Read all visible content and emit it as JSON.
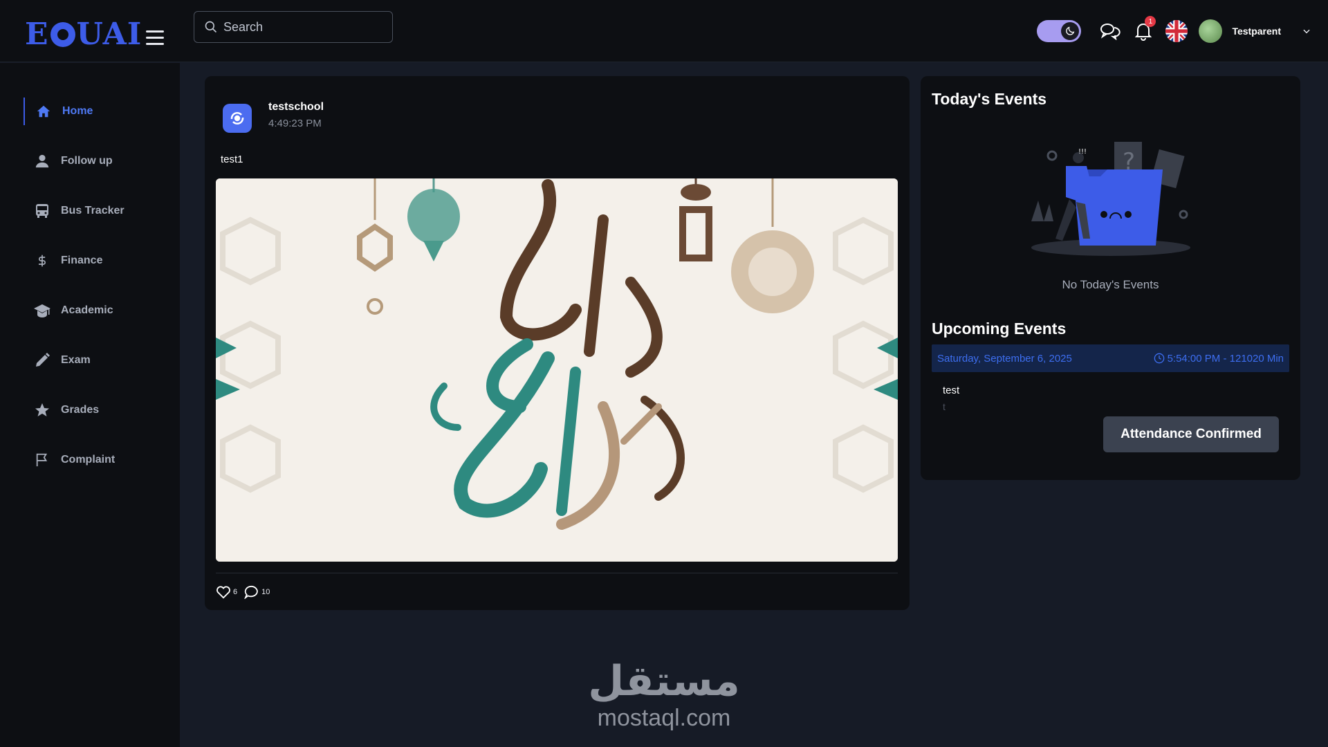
{
  "app": {
    "logo_text": "EDUAI",
    "logo_left": "E",
    "logo_right": "UAI"
  },
  "search": {
    "placeholder": "Search"
  },
  "header": {
    "username": "Testparent",
    "notification_count": "1"
  },
  "colors": {
    "accent": "#3d5ce8",
    "toggle": "#a79cf0",
    "badge": "#e53946",
    "event_bar": "#14254a"
  },
  "sidebar": {
    "items": [
      {
        "label": "Home",
        "icon": "home-icon",
        "active": true
      },
      {
        "label": "Follow up",
        "icon": "user-icon"
      },
      {
        "label": "Bus Tracker",
        "icon": "bus-icon"
      },
      {
        "label": "Finance",
        "icon": "dollar-icon"
      },
      {
        "label": "Academic",
        "icon": "graduation-cap-icon"
      },
      {
        "label": "Exam",
        "icon": "pencil-icon"
      },
      {
        "label": "Grades",
        "icon": "star-icon"
      },
      {
        "label": "Complaint",
        "icon": "flag-icon"
      }
    ]
  },
  "post": {
    "author": "testschool",
    "time": "4:49:23 PM",
    "text": "test1",
    "image_text": "عيد أضحى مبارك",
    "likes": "6",
    "comments": "10"
  },
  "events": {
    "today_title": "Today's Events",
    "today_empty": "No Today's Events",
    "upcoming_title": "Upcoming Events",
    "upcoming": [
      {
        "date": "Saturday, September 6, 2025",
        "time": "5:54:00 PM - 121020 Min",
        "title": "test",
        "description": "t",
        "button": "Attendance Confirmed"
      }
    ]
  },
  "watermark": {
    "arabic": "مستقل",
    "latin": "mostaql.com"
  }
}
